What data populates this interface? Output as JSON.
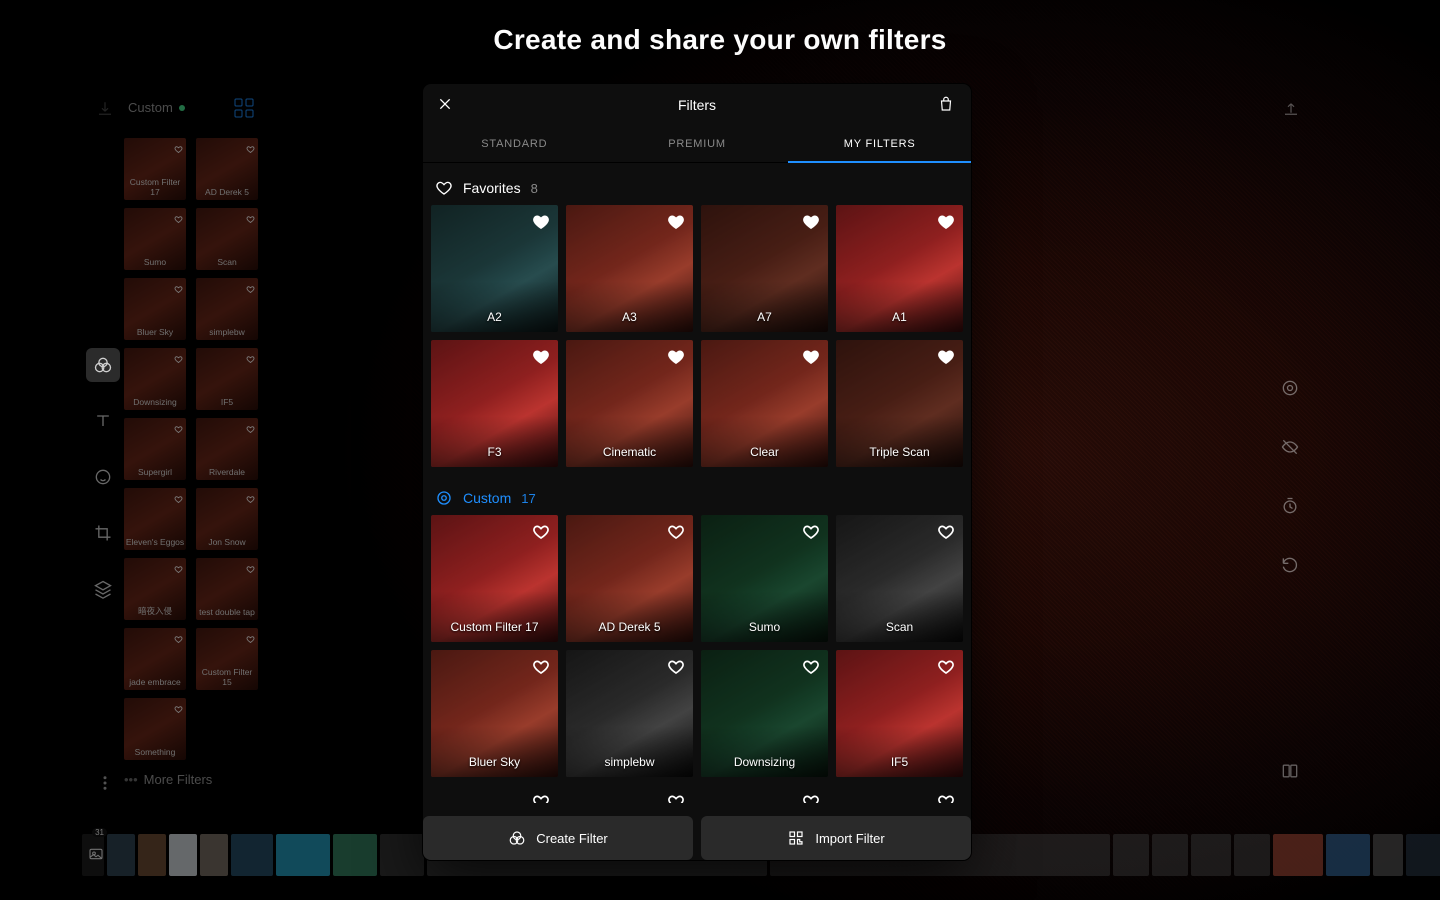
{
  "headline": "Create and share your own filters",
  "topleft": {
    "preset_group": "Custom"
  },
  "panel": {
    "title": "Filters",
    "tabs": [
      "STANDARD",
      "PREMIUM",
      "MY FILTERS"
    ],
    "active_tab": 2
  },
  "sections": {
    "favorites": {
      "label": "Favorites",
      "count": "8"
    },
    "custom": {
      "label": "Custom",
      "count": "17"
    }
  },
  "favorites": [
    {
      "name": "A2",
      "variant": "v-cool"
    },
    {
      "name": "A3",
      "variant": "v-warm"
    },
    {
      "name": "A7",
      "variant": "v-dark"
    },
    {
      "name": "A1",
      "variant": "v-red"
    },
    {
      "name": "F3",
      "variant": "v-red"
    },
    {
      "name": "Cinematic",
      "variant": "v-warm"
    },
    {
      "name": "Clear",
      "variant": "v-warm"
    },
    {
      "name": "Triple Scan",
      "variant": "v-dark"
    }
  ],
  "custom": [
    {
      "name": "Custom Filter 17",
      "variant": "v-red"
    },
    {
      "name": "AD Derek 5",
      "variant": "v-warm"
    },
    {
      "name": "Sumo",
      "variant": "v-teal"
    },
    {
      "name": "Scan",
      "variant": "v-bw"
    },
    {
      "name": "Bluer Sky",
      "variant": "v-warm"
    },
    {
      "name": "simplebw",
      "variant": "v-bw"
    },
    {
      "name": "Downsizing",
      "variant": "v-teal"
    },
    {
      "name": "IF5",
      "variant": "v-red"
    }
  ],
  "sidebar_minis": [
    "Custom Filter 17",
    "AD Derek 5",
    "Sumo",
    "Scan",
    "Bluer Sky",
    "simplebw",
    "Downsizing",
    "IF5",
    "Supergirl",
    "Riverdale",
    "Eleven's Eggos",
    "Jon Snow",
    "暗夜入侵",
    "test double tap",
    "jade embrace",
    "Custom Filter 15",
    "Something",
    ""
  ],
  "buttons": {
    "create": "Create Filter",
    "import": "Import Filter"
  },
  "more_filters_label": "More Filters",
  "filmstrip_lead_count": "31"
}
